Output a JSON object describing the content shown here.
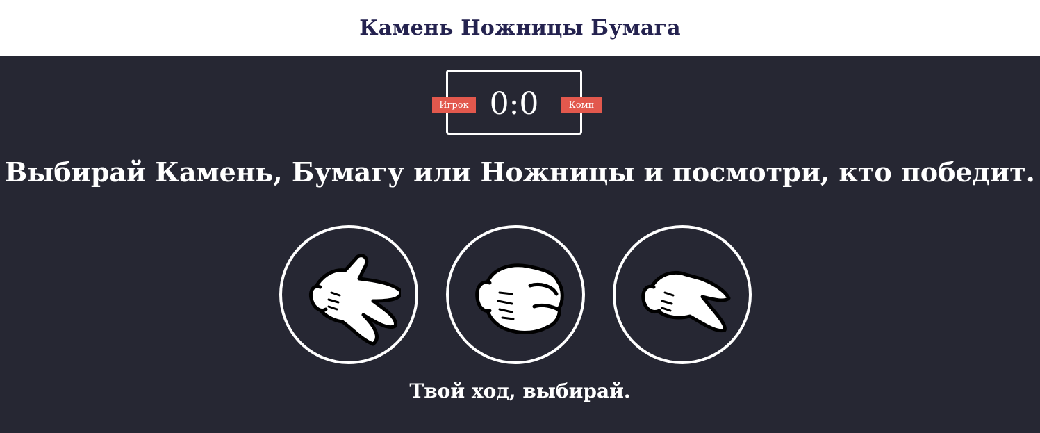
{
  "header": {
    "title": "Камень Ножницы Бумага"
  },
  "scoreboard": {
    "user_label": "Игрок",
    "comp_label": "Комп",
    "user_score": 0,
    "comp_score": 0,
    "score_text": "0:0"
  },
  "prompt": "Выбирай Камень, Бумагу или Ножницы и посмотри, кто победит.",
  "choices": [
    {
      "id": "paper",
      "icon": "paper-hand-icon"
    },
    {
      "id": "rock",
      "icon": "rock-fist-icon"
    },
    {
      "id": "scissors",
      "icon": "scissors-hand-icon"
    }
  ],
  "status": "Твой ход, выбирай.",
  "colors": {
    "header_bg": "#ffffff",
    "title": "#24224f",
    "body_bg": "#262733",
    "badge": "#e2584d",
    "text": "#ffffff"
  }
}
